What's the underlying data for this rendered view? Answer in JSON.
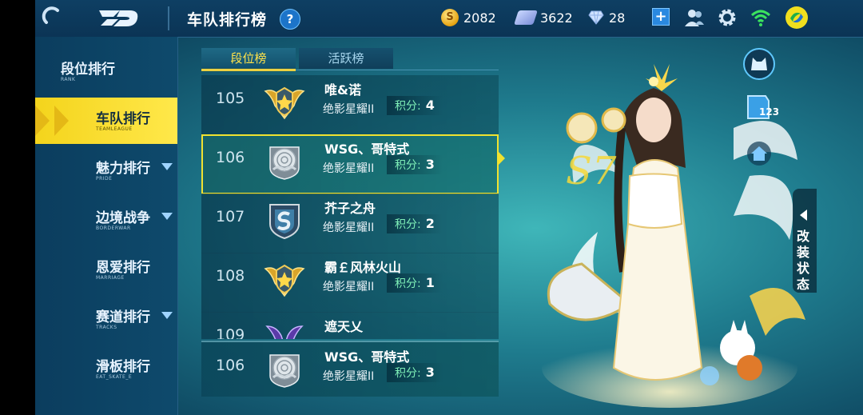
{
  "header": {
    "title": "车队排行榜",
    "help_label": "?",
    "currencies": [
      {
        "icon": "coin-icon",
        "coin_glyph": "S",
        "value": "2082"
      },
      {
        "icon": "ticket-icon",
        "value": "3622"
      },
      {
        "icon": "diamond-icon",
        "value": "28"
      }
    ],
    "plus_label": "+"
  },
  "sidebar": {
    "items": [
      {
        "label": "段位排行",
        "sub": "RANK"
      },
      {
        "label": "车队排行",
        "sub": "TEAMLEAGUE"
      },
      {
        "label": "魅力排行",
        "sub": "PRIDE"
      },
      {
        "label": "边境战争",
        "sub": "BORDERWAR"
      },
      {
        "label": "恩爱排行",
        "sub": "MARRIAGE"
      },
      {
        "label": "赛道排行",
        "sub": "TRACKS"
      },
      {
        "label": "滑板排行",
        "sub": "EAT_SKATE_E"
      }
    ]
  },
  "tabs": [
    {
      "label": "段位榜"
    },
    {
      "label": "活跃榜"
    }
  ],
  "list": {
    "rows": [
      {
        "rank": "105",
        "name": "唯&诺",
        "tier": "绝影星耀II",
        "score_label": "积分:",
        "score": "4",
        "badge": "gold-wing-badge-icon"
      },
      {
        "rank": "106",
        "name": "WSG、哥特式",
        "tier": "绝影星耀II",
        "score_label": "积分:",
        "score": "3",
        "badge": "silver-rose-badge-icon"
      },
      {
        "rank": "107",
        "name": "芥子之舟",
        "tier": "绝影星耀II",
        "score_label": "积分:",
        "score": "2",
        "badge": "blue-shield-badge-icon"
      },
      {
        "rank": "108",
        "name": "霸￡风林火山",
        "tier": "绝影星耀II",
        "score_label": "积分:",
        "score": "1",
        "badge": "gold-wing-badge-icon"
      },
      {
        "rank": "109",
        "name": "遮天乂",
        "tier": "",
        "score_label": "",
        "score": "",
        "badge": "purple-wing-badge-icon"
      }
    ],
    "pinned": {
      "rank": "106",
      "name": "WSG、哥特式",
      "tier": "绝影星耀II",
      "score_label": "积分:",
      "score": "3",
      "badge": "silver-rose-badge-icon"
    }
  },
  "right_panel": {
    "level_badge": "123",
    "mod_status_label": "改装状态",
    "s7_text": "S7"
  },
  "colors": {
    "accent_yellow": "#f4d41c",
    "score_green": "#7ff0b8"
  }
}
